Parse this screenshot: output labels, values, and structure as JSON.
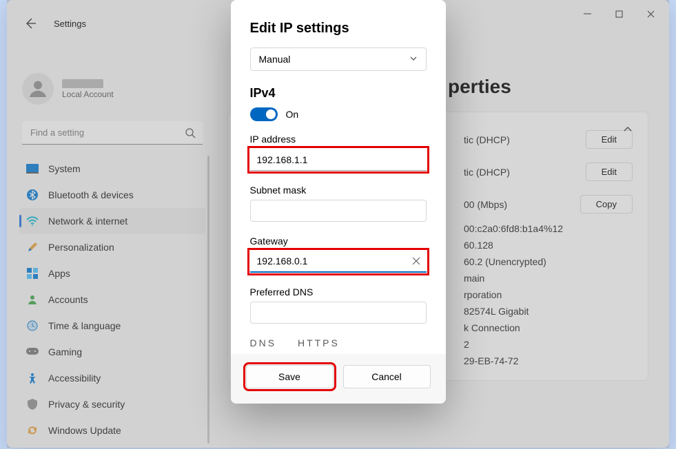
{
  "header": {
    "app": "Settings"
  },
  "account": {
    "subtitle": "Local Account"
  },
  "search": {
    "placeholder": "Find a setting"
  },
  "nav": {
    "items": [
      {
        "label": "System"
      },
      {
        "label": "Bluetooth & devices"
      },
      {
        "label": "Network & internet"
      },
      {
        "label": "Personalization"
      },
      {
        "label": "Apps"
      },
      {
        "label": "Accounts"
      },
      {
        "label": "Time & language"
      },
      {
        "label": "Gaming"
      },
      {
        "label": "Accessibility"
      },
      {
        "label": "Privacy & security"
      },
      {
        "label": "Windows Update"
      }
    ]
  },
  "page": {
    "title_suffix": "perties"
  },
  "card": {
    "rows": [
      {
        "value": "tic (DHCP)",
        "btn": "Edit"
      },
      {
        "value": "tic (DHCP)",
        "btn": "Edit"
      },
      {
        "value": "00 (Mbps)",
        "btn": "Copy"
      },
      {
        "value": "00:c2a0:6fd8:b1a4%12",
        "btn": ""
      },
      {
        "value": "60.128",
        "btn": ""
      },
      {
        "value": "60.2 (Unencrypted)",
        "btn": ""
      },
      {
        "value": "main",
        "btn": ""
      },
      {
        "value": "rporation",
        "btn": ""
      },
      {
        "value": "82574L Gigabit",
        "btn": ""
      },
      {
        "value": "k Connection",
        "btn": ""
      },
      {
        "value": "2",
        "btn": ""
      },
      {
        "value": "29-EB-74-72",
        "btn": ""
      }
    ]
  },
  "dialog": {
    "title": "Edit IP settings",
    "mode": "Manual",
    "section": "IPv4",
    "toggle_label": "On",
    "ip_label": "IP address",
    "ip_value": "192.168.1.1",
    "subnet_label": "Subnet mask",
    "subnet_value": "",
    "gateway_label": "Gateway",
    "gateway_value": "192.168.0.1",
    "dns_label": "Preferred DNS",
    "dns_value": "",
    "cutoff": "DNS over HTTPS",
    "save": "Save",
    "cancel": "Cancel"
  }
}
